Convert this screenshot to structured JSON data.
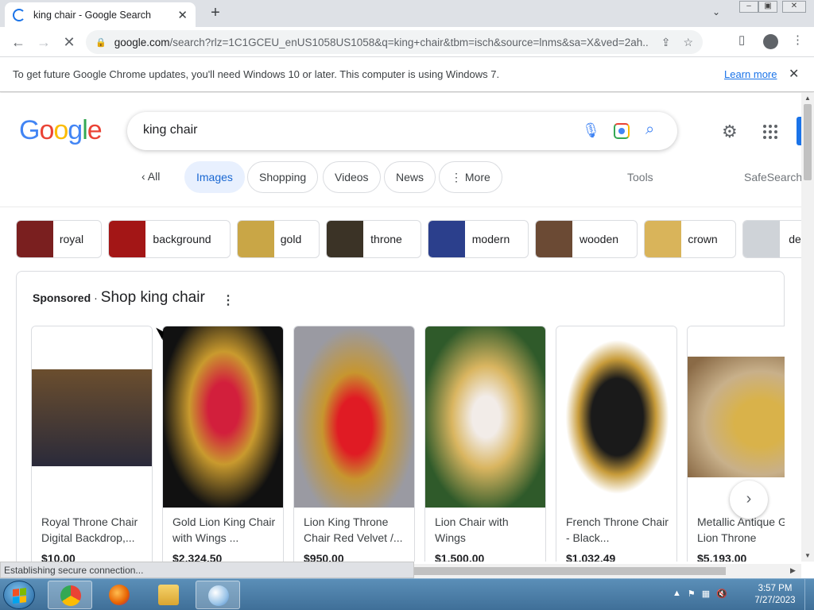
{
  "browser": {
    "tab_title": "king chair - Google Search",
    "url_host": "google.com",
    "url_rest": "/search?rlz=1C1GCEU_enUS1058US1058&q=king+chair&tbm=isch&source=lnms&sa=X&ved=2ah...",
    "infobar_message": "To get future Google Chrome updates, you'll need Windows 10 or later. This computer is using Windows 7.",
    "infobar_link": "Learn more",
    "status_text": "Establishing secure connection..."
  },
  "search": {
    "logo": [
      "G",
      "o",
      "o",
      "g",
      "l",
      "e"
    ],
    "query": "king chair"
  },
  "nav": {
    "all": "All",
    "tabs": [
      "Images",
      "Shopping",
      "Videos",
      "News",
      "More"
    ],
    "selected": "Images",
    "tools": "Tools",
    "safesearch": "SafeSearch"
  },
  "related": [
    {
      "label": "royal",
      "color": "#7a1f1f"
    },
    {
      "label": "background",
      "color": "#a31616"
    },
    {
      "label": "gold",
      "color": "#c9a646"
    },
    {
      "label": "throne",
      "color": "#3b3326"
    },
    {
      "label": "modern",
      "color": "#2b3f8c"
    },
    {
      "label": "wooden",
      "color": "#6b4a34"
    },
    {
      "label": "crown",
      "color": "#d9b45a"
    },
    {
      "label": "de",
      "color": "#cfd3d8"
    }
  ],
  "shopping": {
    "sponsored": "Sponsored",
    "separator": "·",
    "title": "Shop king chair",
    "products": [
      {
        "name": "Royal Throne Chair Digital Backdrop,...",
        "price": "$10.00",
        "color": "#4a3a2a"
      },
      {
        "name": "Gold Lion King Chair with Wings ...",
        "price": "$2,324.50",
        "color": "#c7273a"
      },
      {
        "name": "Lion King Throne Chair Red Velvet /...",
        "price": "$950.00",
        "color": "#d11f2a"
      },
      {
        "name": "Lion Chair with Wings",
        "price": "$1,500.00",
        "color": "#d9c27a"
      },
      {
        "name": "French Throne Chair - Black...",
        "price": "$1,032.49",
        "color": "#1e1e1e"
      },
      {
        "name": "Metallic Antique Gold Lion Throne",
        "price": "$5,193.00",
        "color": "#caa85e"
      }
    ]
  },
  "taskbar": {
    "time": "3:57 PM",
    "date": "7/27/2023"
  }
}
